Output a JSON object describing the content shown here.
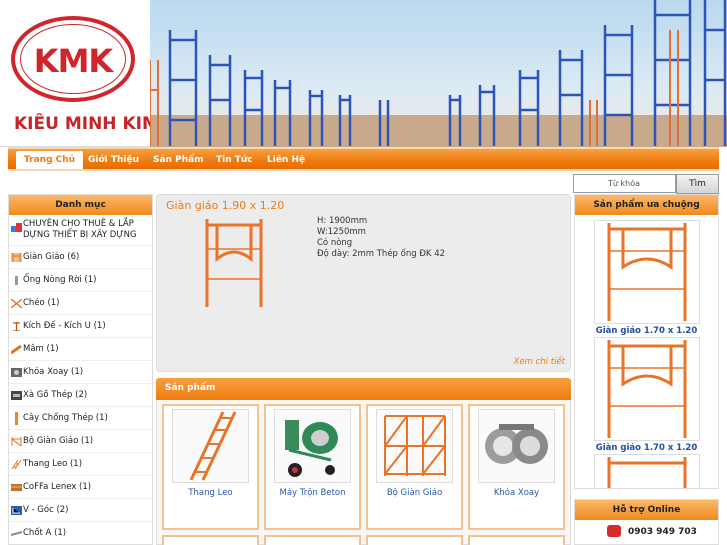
{
  "header": {
    "logo_text": "KMK",
    "brand_name": "KIÊU MINH KIM"
  },
  "nav": {
    "items": [
      {
        "label": "Trang Chủ",
        "active": true
      },
      {
        "label": "Giới Thiệu",
        "active": false
      },
      {
        "label": "Sản Phẩm",
        "active": false
      },
      {
        "label": "Tin Tức",
        "active": false
      },
      {
        "label": "Liên Hệ",
        "active": false
      }
    ]
  },
  "search": {
    "placeholder": "Từ khóa",
    "button_label": "Tìm"
  },
  "sidebar": {
    "title": "Danh mục",
    "items": [
      {
        "label": "CHUYÊN CHO THUÊ & LẮP DỰNG THIẾT BỊ XÂY DỰNG",
        "icon": "construction-icon"
      },
      {
        "label": "Giàn Giáo (6)",
        "icon": "scaffold-icon"
      },
      {
        "label": "Ống Nòng Rời (1)",
        "icon": "pipe-icon"
      },
      {
        "label": "Chéo (1)",
        "icon": "cross-brace-icon"
      },
      {
        "label": "Kích Đế - Kích U (1)",
        "icon": "jack-icon"
      },
      {
        "label": "Mâm (1)",
        "icon": "plank-icon"
      },
      {
        "label": "Khóa Xoay (1)",
        "icon": "clamp-icon"
      },
      {
        "label": "Xà Gồ Thép (2)",
        "icon": "beam-icon"
      },
      {
        "label": "Cây Chống Thép (1)",
        "icon": "prop-icon"
      },
      {
        "label": "Bộ Giàn Giáo (1)",
        "icon": "scaffold-set-icon"
      },
      {
        "label": "Thang Leo (1)",
        "icon": "ladder-icon"
      },
      {
        "label": "CoFFa Lenex (1)",
        "icon": "formwork-icon"
      },
      {
        "label": "V - Góc (2)",
        "icon": "angle-icon"
      },
      {
        "label": "Chốt A (1)",
        "icon": "pin-icon"
      }
    ]
  },
  "featured": {
    "title": "Giàn giáo 1.90 x 1.20",
    "specs": [
      "H: 1900mm",
      "W:1250mm",
      "Có nòng",
      "Độ dày: 2mm Thép ống ĐK 42"
    ],
    "more_link": "Xem chi tiết"
  },
  "products": {
    "title": "Sản phẩm",
    "items": [
      {
        "name": "Thang Leo",
        "image": "ladder-image"
      },
      {
        "name": "Máy Trộn Beton",
        "image": "concrete-mixer-image"
      },
      {
        "name": "Bộ Giàn Giáo",
        "image": "scaffold-set-image"
      },
      {
        "name": "Khóa Xoay",
        "image": "swivel-clamp-image"
      }
    ]
  },
  "favorites": {
    "title": "Sản phẩm ưa chuộng",
    "items": [
      {
        "name": "Giàn giáo 1.70 x 1.20"
      },
      {
        "name": "Giàn giáo 1.70 x 1.20"
      }
    ]
  },
  "support": {
    "title": "Hỗ trợ Online",
    "phone": "0903 949 703"
  },
  "colors": {
    "accent": "#ef7b10",
    "logo_red": "#d0262b",
    "link_blue": "#2a58a8"
  }
}
